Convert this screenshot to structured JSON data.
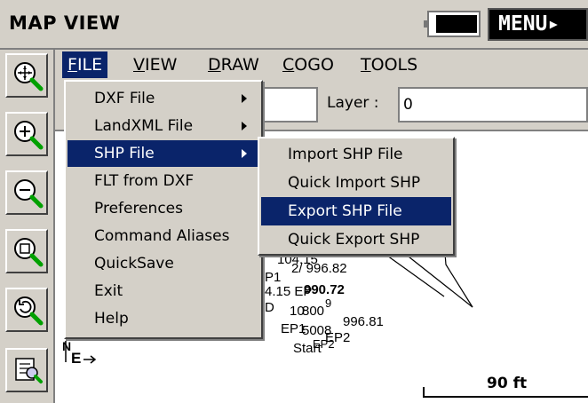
{
  "window": {
    "title": "MAP VIEW",
    "menu_button": "MENU▸"
  },
  "menubar": {
    "file": "FILE",
    "view": "VIEW",
    "draw": "DRAW",
    "cogo": "COGO",
    "tools": "TOOLS"
  },
  "layerbar": {
    "layer_label": "Layer :",
    "layer_value": "0"
  },
  "file_menu": {
    "items": [
      {
        "label": "DXF File",
        "submenu": true
      },
      {
        "label": "LandXML File",
        "submenu": true
      },
      {
        "label": "SHP File",
        "submenu": true,
        "selected": true
      },
      {
        "label": "FLT from DXF"
      },
      {
        "label": "Preferences"
      },
      {
        "label": "Command Aliases"
      },
      {
        "label": "QuickSave"
      },
      {
        "label": "Exit"
      },
      {
        "label": "Help"
      }
    ]
  },
  "shp_submenu": {
    "items": [
      {
        "label": "Import SHP File"
      },
      {
        "label": "Quick Import SHP"
      },
      {
        "label": "Export SHP File",
        "selected": true
      },
      {
        "label": "Quick Export SHP"
      }
    ]
  },
  "map": {
    "labels": [
      "104.15",
      "2/ 996.82",
      "P1",
      "4.15 EP",
      "990.72",
      "D",
      "10",
      "800",
      "9",
      "EP1",
      "5008",
      "996.81",
      "EP2",
      "Start",
      "EP2"
    ],
    "north": "N",
    "east": "E",
    "scale": "90 ft"
  },
  "toolbar": [
    "zoom-extents-icon",
    "zoom-in-icon",
    "zoom-out-icon",
    "zoom-window-icon",
    "zoom-previous-icon",
    "identify-icon"
  ],
  "colors": {
    "chrome": "#d4d0c8",
    "highlight": "#0a246a"
  }
}
